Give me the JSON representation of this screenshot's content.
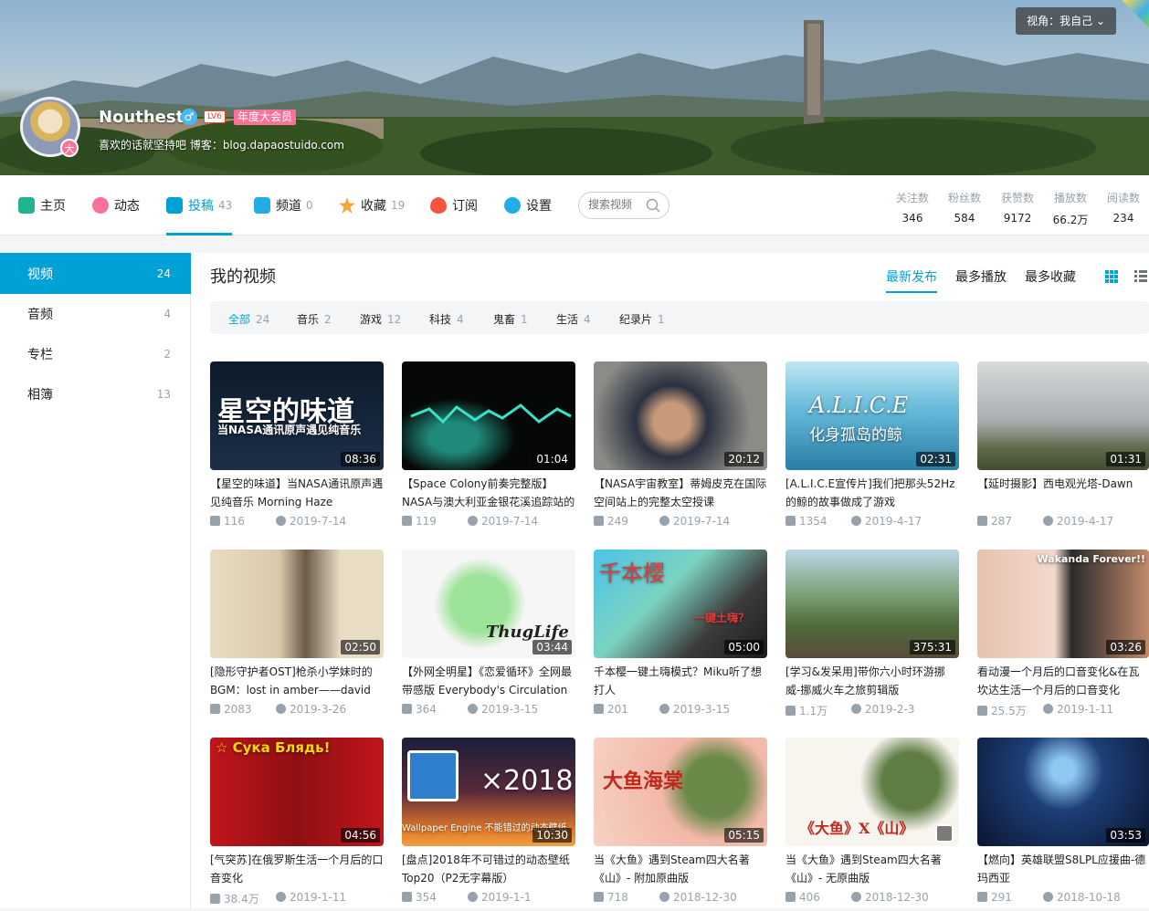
{
  "header": {
    "view_select": "视角：我自己",
    "username": "Nouthest",
    "level": "LV6",
    "vip": "年度大会员",
    "avatar_badge": "大",
    "sign": "喜欢的话就坚持吧 博客：blog.dapaostuido.com"
  },
  "nav": {
    "items": [
      {
        "label": "主页",
        "count": ""
      },
      {
        "label": "动态",
        "count": ""
      },
      {
        "label": "投稿",
        "count": "43"
      },
      {
        "label": "频道",
        "count": "0"
      },
      {
        "label": "收藏",
        "count": "19"
      },
      {
        "label": "订阅",
        "count": ""
      },
      {
        "label": "设置",
        "count": ""
      }
    ],
    "search_placeholder": "搜索视频"
  },
  "stats": [
    {
      "label": "关注数",
      "value": "346"
    },
    {
      "label": "粉丝数",
      "value": "584"
    },
    {
      "label": "获赞数",
      "value": "9172"
    },
    {
      "label": "播放数",
      "value": "66.2万"
    },
    {
      "label": "阅读数",
      "value": "234"
    }
  ],
  "sidebar": [
    {
      "label": "视频",
      "count": "24"
    },
    {
      "label": "音频",
      "count": "4"
    },
    {
      "label": "专栏",
      "count": "2"
    },
    {
      "label": "相簿",
      "count": "13"
    }
  ],
  "main": {
    "title": "我的视频",
    "sorts": [
      "最新发布",
      "最多播放",
      "最多收藏"
    ],
    "filters": [
      {
        "label": "全部",
        "count": "24"
      },
      {
        "label": "音乐",
        "count": "2"
      },
      {
        "label": "游戏",
        "count": "12"
      },
      {
        "label": "科技",
        "count": "4"
      },
      {
        "label": "鬼畜",
        "count": "1"
      },
      {
        "label": "生活",
        "count": "4"
      },
      {
        "label": "纪录片",
        "count": "1"
      }
    ]
  },
  "videos": [
    {
      "title": "【星空的味道】当NASA通讯原声遇见纯音乐 Morning Haze",
      "duration": "08:36",
      "plays": "116",
      "date": "2019-7-14",
      "overlay": "星空的味道",
      "overlay2": "当NASA通讯原声遇见纯音乐"
    },
    {
      "title": "【Space Colony前奏完整版】NASA与澳大利亚金银花溪追踪站的",
      "duration": "01:04",
      "plays": "119",
      "date": "2019-7-14"
    },
    {
      "title": "【NASA宇宙教室】蒂姆皮克在国际空间站上的完整太空授课",
      "duration": "20:12",
      "plays": "249",
      "date": "2019-7-14"
    },
    {
      "title": "[A.L.I.C.E宣传片]我们把那头52Hz的鲸的故事做成了游戏",
      "duration": "02:31",
      "plays": "1354",
      "date": "2019-4-17",
      "overlay": "A.L.I.C.E",
      "overlay2": "化身孤岛的鲸"
    },
    {
      "title": "【延时摄影】西电观光塔-Dawn",
      "duration": "01:31",
      "plays": "287",
      "date": "2019-4-17"
    },
    {
      "title": "[隐形守护者OST]枪杀小学妹时的BGM：lost in amber——david",
      "duration": "02:50",
      "plays": "2083",
      "date": "2019-3-26"
    },
    {
      "title": "【外网全明星】《恋爱循环》全网最带感版 Everybody's Circulation",
      "duration": "03:44",
      "plays": "364",
      "date": "2019-3-15",
      "overlay": "ThugLife"
    },
    {
      "title": "千本樱一键土嗨模式？Miku听了想打人",
      "duration": "05:00",
      "plays": "201",
      "date": "2019-3-15",
      "overlay": "千本樱",
      "overlay2": "一键土嗨？"
    },
    {
      "title": "[学习&发呆用]带你六小时环游挪威-挪威火车之旅剪辑版",
      "duration": "375:31",
      "plays": "1.1万",
      "date": "2019-2-3"
    },
    {
      "title": "看动漫一个月后的口音变化&在瓦坎达生活一个月后的口音变化",
      "duration": "03:26",
      "plays": "25.5万",
      "date": "2019-1-11",
      "overlay": "Wakanda Forever!!"
    },
    {
      "title": "[气突苏]在俄罗斯生活一个月后的口音变化",
      "duration": "04:56",
      "plays": "38.4万",
      "date": "2019-1-11",
      "overlay": "☆ Сука Блядь!"
    },
    {
      "title": "[盘点]2018年不可错过的动态壁纸Top20（P2无字幕版）",
      "duration": "10:30",
      "plays": "354",
      "date": "2019-1-1",
      "overlay": "×2018",
      "overlay2": "Wallpaper Engine 不能错过的动态壁纸"
    },
    {
      "title": "当《大鱼》遇到Steam四大名著《山》- 附加原曲版",
      "duration": "05:15",
      "plays": "718",
      "date": "2018-12-30",
      "overlay": "大鱼海棠"
    },
    {
      "title": "当《大鱼》遇到Steam四大名著《山》- 无原曲版",
      "duration": "",
      "plays": "406",
      "date": "2018-12-30",
      "overlay": "《大鱼》X《山》"
    },
    {
      "title": "【燃向】英雄联盟S8LPL应援曲-德玛西亚",
      "duration": "03:53",
      "plays": "291",
      "date": "2018-10-18"
    }
  ],
  "colors": {
    "accent": "#00a1d6",
    "pink": "#fb7299",
    "muted": "#99a2aa"
  }
}
